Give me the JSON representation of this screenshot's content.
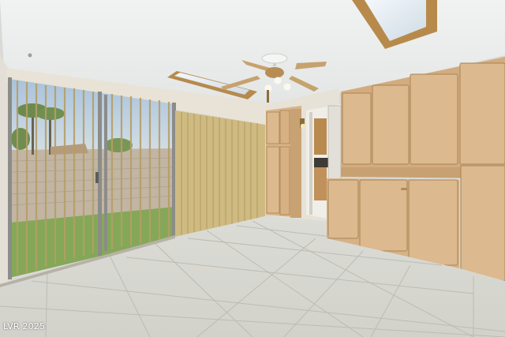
{
  "watermark": "LVR 2025",
  "colors": {
    "ceiling": "#eceeee",
    "wall": "#e7e4dc",
    "cabinet": "#dcb98e",
    "cabinet_shade": "#c9a273",
    "cabinet_trim": "#a98456",
    "blind": "#cdbb86",
    "blind_line": "#b09a62",
    "floor": "#d9d9d3",
    "grout": "#b9b9b3",
    "lawn": "#86a95a",
    "block_wall": "#c4b7a6",
    "sky": "#b8cce0",
    "skylight": "#e4edf3"
  }
}
